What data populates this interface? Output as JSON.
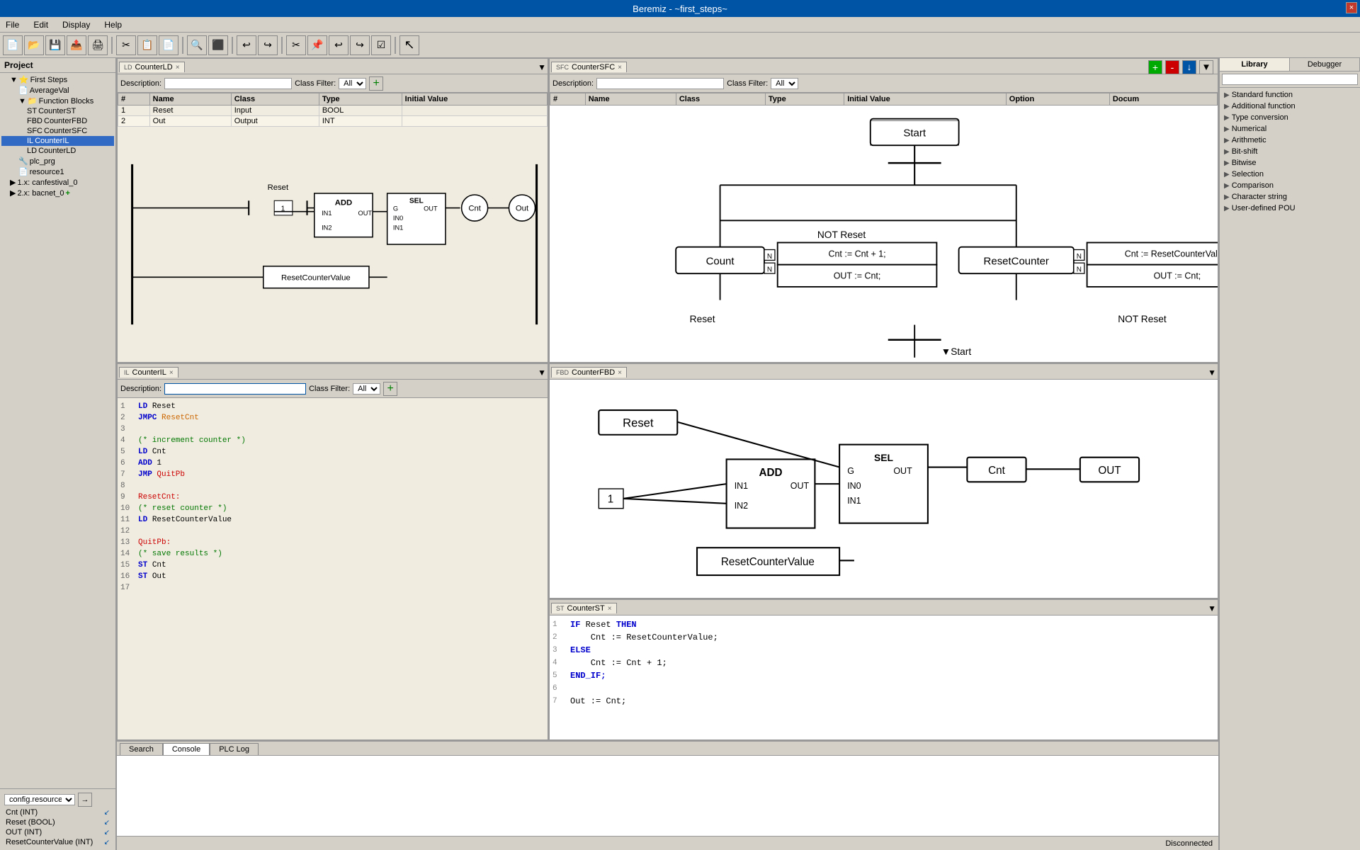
{
  "app": {
    "title": "Beremiz - ~first_steps~",
    "close_btn": "×"
  },
  "menubar": {
    "items": [
      "File",
      "Edit",
      "Display",
      "Help"
    ]
  },
  "toolbar": {
    "buttons": [
      "📄",
      "📂",
      "💾",
      "📤",
      "🖨",
      "✂",
      "📋",
      "📄",
      "🔍",
      "⬛",
      "↩",
      "↪",
      "✂",
      "📌",
      "↩",
      "↩",
      "↪",
      "☑",
      "🖱"
    ]
  },
  "project": {
    "header": "Project",
    "tree": [
      {
        "level": 1,
        "label": "First Steps",
        "icon": "▶",
        "type": "root"
      },
      {
        "level": 2,
        "label": "AverageVal",
        "icon": "📄",
        "type": "pou"
      },
      {
        "level": 2,
        "label": "Function Blocks",
        "icon": "📁",
        "type": "folder"
      },
      {
        "level": 3,
        "label": "CounterST",
        "icon": "📄",
        "type": "pou"
      },
      {
        "level": 3,
        "label": "CounterFBD",
        "icon": "📄",
        "type": "pou"
      },
      {
        "level": 3,
        "label": "CounterSFC",
        "icon": "📄",
        "type": "pou"
      },
      {
        "level": 3,
        "label": "CounterIL",
        "icon": "📄",
        "type": "pou",
        "selected": true
      },
      {
        "level": 3,
        "label": "CounterLD",
        "icon": "📄",
        "type": "pou"
      },
      {
        "level": 2,
        "label": "plc_prg",
        "icon": "📄",
        "type": "pou"
      },
      {
        "level": 2,
        "label": "resource1",
        "icon": "📄",
        "type": "resource"
      },
      {
        "level": 1,
        "label": "1.x: canfestival_0",
        "icon": "▶",
        "type": "config"
      },
      {
        "level": 1,
        "label": "2.x: bacnet_0",
        "icon": "▶+",
        "type": "config"
      }
    ]
  },
  "config": {
    "label": "config.resource",
    "vars": [
      {
        "name": "Cnt (INT)",
        "arrow": "↙"
      },
      {
        "name": "Reset (BOOL)",
        "arrow": "↙"
      },
      {
        "name": "OUT (INT)",
        "arrow": "↙"
      },
      {
        "name": "ResetCounterValue (INT)",
        "arrow": "↙"
      }
    ]
  },
  "counterLD": {
    "tab_label": "CounterLD",
    "tab_icon": "LD",
    "description_label": "Description:",
    "description_value": "",
    "class_filter_label": "Class Filter:",
    "class_filter_value": "All",
    "variables": [
      {
        "num": "1",
        "name": "Reset",
        "class": "Input",
        "type": "BOOL",
        "initial": ""
      },
      {
        "num": "2",
        "name": "Out",
        "class": "Output",
        "type": "INT",
        "initial": ""
      }
    ],
    "col_headers": [
      "#",
      "Name",
      "Class",
      "Type",
      "Initial Value"
    ]
  },
  "counterSFC": {
    "tab_label": "CounterSFC",
    "tab_icon": "SFC",
    "description_label": "Description:",
    "class_filter_label": "Class Filter:",
    "class_filter_value": "All",
    "col_headers": [
      "#",
      "Name",
      "Class",
      "Type",
      "Initial Value",
      "Option",
      "Docum"
    ]
  },
  "counterIL": {
    "tab_label": "CounterIL",
    "tab_icon": "IL",
    "description_label": "Description:",
    "class_filter_label": "Class Filter:",
    "class_filter_value": "All",
    "lines": [
      {
        "num": "1",
        "content": "LD Reset",
        "parts": [
          {
            "text": "LD ",
            "class": "il-kw"
          },
          {
            "text": "Reset",
            "class": ""
          }
        ]
      },
      {
        "num": "2",
        "content": "JMPC ResetCnt",
        "parts": [
          {
            "text": "JMPC ",
            "class": "il-kw"
          },
          {
            "text": "ResetCnt",
            "class": "il-var"
          }
        ]
      },
      {
        "num": "3",
        "content": "",
        "parts": []
      },
      {
        "num": "4",
        "content": "(* increment counter *)",
        "parts": [
          {
            "text": "(* increment counter *)",
            "class": "il-comment"
          }
        ]
      },
      {
        "num": "5",
        "content": "LD Cnt",
        "parts": [
          {
            "text": "LD ",
            "class": "il-kw"
          },
          {
            "text": "Cnt",
            "class": ""
          }
        ]
      },
      {
        "num": "6",
        "content": "ADD 1",
        "parts": [
          {
            "text": "ADD ",
            "class": "il-kw"
          },
          {
            "text": "1",
            "class": ""
          }
        ]
      },
      {
        "num": "7",
        "content": "JMP QuitPb",
        "parts": [
          {
            "text": "JMP ",
            "class": "il-kw"
          },
          {
            "text": "QuitPb",
            "class": "il-label"
          }
        ]
      },
      {
        "num": "8",
        "content": "",
        "parts": []
      },
      {
        "num": "9",
        "content": "ResetCnt:",
        "parts": [
          {
            "text": "ResetCnt:",
            "class": "il-label"
          }
        ]
      },
      {
        "num": "10",
        "content": "(* reset counter *)",
        "parts": [
          {
            "text": "(* reset counter *)",
            "class": "il-comment"
          }
        ]
      },
      {
        "num": "11",
        "content": "LD ResetCounterValue",
        "parts": [
          {
            "text": "LD ",
            "class": "il-kw"
          },
          {
            "text": "ResetCounterValue",
            "class": ""
          }
        ]
      },
      {
        "num": "12",
        "content": "",
        "parts": []
      },
      {
        "num": "13",
        "content": "QuitPb:",
        "parts": [
          {
            "text": "QuitPb:",
            "class": "il-label"
          }
        ]
      },
      {
        "num": "14",
        "content": "(* save results *)",
        "parts": [
          {
            "text": "(* save results *)",
            "class": "il-comment"
          }
        ]
      },
      {
        "num": "15",
        "content": "ST Cnt",
        "parts": [
          {
            "text": "ST ",
            "class": "il-kw"
          },
          {
            "text": "Cnt",
            "class": ""
          }
        ]
      },
      {
        "num": "16",
        "content": "ST Out",
        "parts": [
          {
            "text": "ST ",
            "class": "il-kw"
          },
          {
            "text": "Out",
            "class": ""
          }
        ]
      },
      {
        "num": "17",
        "content": "",
        "parts": []
      }
    ]
  },
  "counterFBD": {
    "tab_label": "CounterFBD",
    "tab_icon": "FBD"
  },
  "counterST": {
    "tab_label": "CounterST",
    "tab_icon": "ST",
    "lines": [
      {
        "num": "1",
        "content": "IF Reset THEN",
        "parts": [
          {
            "text": "IF ",
            "cls": "kw"
          },
          {
            "text": "Reset",
            "cls": ""
          },
          {
            "text": " THEN",
            "cls": "kw"
          }
        ]
      },
      {
        "num": "2",
        "content": "  Cnt := ResetCounterValue;",
        "parts": [
          {
            "text": "    Cnt := ResetCounterValue;",
            "cls": ""
          }
        ]
      },
      {
        "num": "3",
        "content": "ELSE",
        "parts": [
          {
            "text": "ELSE",
            "cls": "kw"
          }
        ]
      },
      {
        "num": "4",
        "content": "  Cnt := Cnt + 1;",
        "parts": [
          {
            "text": "    Cnt := Cnt + 1;",
            "cls": ""
          }
        ]
      },
      {
        "num": "5",
        "content": "END_IF;",
        "parts": [
          {
            "text": "END_IF;",
            "cls": "kw"
          }
        ]
      },
      {
        "num": "6",
        "content": "",
        "parts": []
      },
      {
        "num": "7",
        "content": "Out := Cnt;",
        "parts": [
          {
            "text": "Out := Cnt;",
            "cls": ""
          }
        ]
      }
    ]
  },
  "console_tabs": [
    "Search",
    "Console",
    "PLC Log"
  ],
  "console_active": "Console",
  "status": {
    "text": "Disconnected"
  },
  "library": {
    "tabs": [
      "Library",
      "Debugger"
    ],
    "active_tab": "Library",
    "search_placeholder": "",
    "items": [
      {
        "label": "Standard function",
        "level": 0,
        "expand": "▶"
      },
      {
        "label": "Additional function",
        "level": 0,
        "expand": "▶"
      },
      {
        "label": "Type conversion",
        "level": 0,
        "expand": "▶"
      },
      {
        "label": "Numerical",
        "level": 0,
        "expand": "▶"
      },
      {
        "label": "Arithmetic",
        "level": 0,
        "expand": "▶"
      },
      {
        "label": "Bit-shift",
        "level": 0,
        "expand": "▶"
      },
      {
        "label": "Bitwise",
        "level": 0,
        "expand": "▶"
      },
      {
        "label": "Selection",
        "level": 0,
        "expand": "▶"
      },
      {
        "label": "Comparison",
        "level": 0,
        "expand": "▶"
      },
      {
        "label": "Character string",
        "level": 0,
        "expand": "▶"
      },
      {
        "label": "User-defined POU",
        "level": 0,
        "expand": "▶"
      }
    ]
  }
}
